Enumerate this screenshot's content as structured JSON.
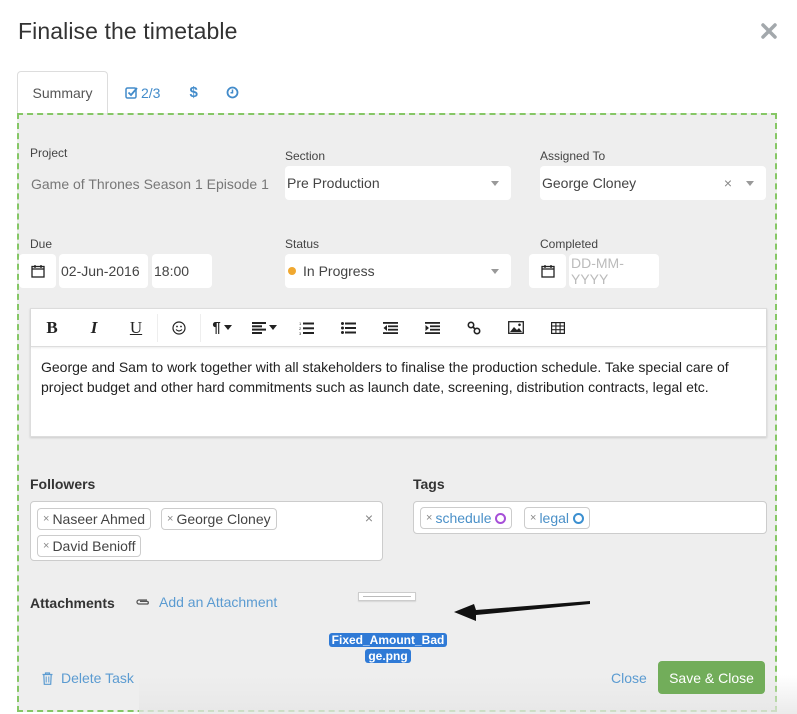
{
  "dialog": {
    "title": "Finalise the timetable",
    "close_icon": "close-icon"
  },
  "tabs": [
    {
      "label": "Summary",
      "active": true
    },
    {
      "label": "2/3",
      "icon": "checkbox-icon"
    },
    {
      "label": "",
      "icon": "dollar-icon"
    },
    {
      "label": "",
      "icon": "clock-icon"
    }
  ],
  "form": {
    "project": {
      "label": "Project",
      "value": "Game of Thrones Season 1 Episode 1"
    },
    "section": {
      "label": "Section",
      "value": "Pre Production"
    },
    "assigned_to": {
      "label": "Assigned To",
      "value": "George Cloney"
    },
    "due": {
      "label": "Due",
      "date": "02-Jun-2016",
      "time": "18:00"
    },
    "status": {
      "label": "Status",
      "value": "In Progress",
      "color": "#f0a830"
    },
    "completed": {
      "label": "Completed",
      "placeholder": "DD-MM-YYYY"
    }
  },
  "editor": {
    "toolbar": [
      "bold",
      "italic",
      "underline",
      "emoji",
      "paragraph",
      "align",
      "ordered-list",
      "unordered-list",
      "outdent",
      "indent",
      "link",
      "image",
      "table"
    ],
    "bold_label": "B",
    "italic_label": "I",
    "underline_label": "U",
    "content": "George and Sam to work together with all stakeholders to finalise the production schedule. Take special care of project budget and other hard commitments such as launch date, screening, distribution contracts, legal etc."
  },
  "followers": {
    "label": "Followers",
    "items": [
      "Naseer Ahmed",
      "George Cloney",
      "David Benioff"
    ]
  },
  "tags": {
    "label": "Tags",
    "items": [
      {
        "name": "schedule",
        "color": "#a64fd8"
      },
      {
        "name": "legal",
        "color": "#3b8fd0"
      }
    ]
  },
  "attachments": {
    "label": "Attachments",
    "add_label": "Add an Attachment",
    "dragging_file": "Fixed_Amount_Badge.png",
    "dragging_file_line1": "Fixed_Amount_Bad",
    "dragging_file_line2": "ge.png"
  },
  "footer": {
    "delete_label": "Delete Task",
    "close_label": "Close",
    "save_label": "Save & Close"
  },
  "x_glyph": "×",
  "colors": {
    "accent": "#428bca",
    "save": "#72ad5a",
    "drop_border": "#86c766"
  }
}
